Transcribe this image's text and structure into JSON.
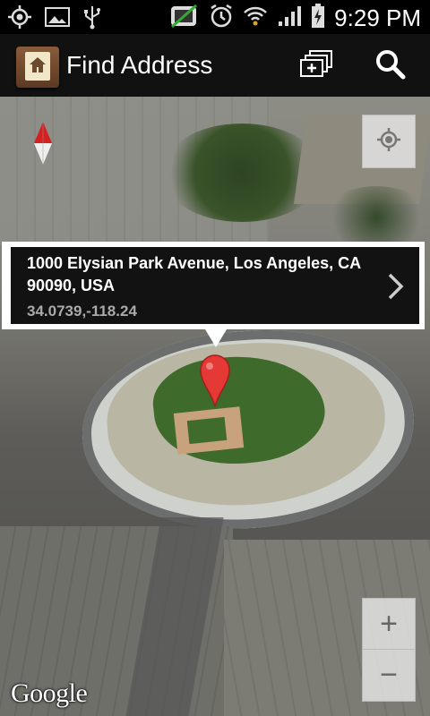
{
  "status_bar": {
    "time": "9:29 PM",
    "icons": [
      "gps-icon",
      "image-icon",
      "usb-icon",
      "silent-icon",
      "alarm-icon",
      "wifi-icon",
      "signal-icon",
      "battery-charging-icon"
    ]
  },
  "action_bar": {
    "title": "Find Address",
    "app_icon": "address-book-home-icon",
    "actions": [
      "layers-add-icon",
      "search-icon"
    ]
  },
  "map": {
    "info_window": {
      "address": "1000 Elysian Park Avenue, Los Angeles, CA 90090, USA",
      "coordinates": "34.0739,-118.24"
    },
    "zoom_in_label": "+",
    "zoom_out_label": "−",
    "attribution": "Google",
    "colors": {
      "pin": "#e53935",
      "info_bg": "#121212",
      "coords": "#aaaaaa"
    }
  }
}
